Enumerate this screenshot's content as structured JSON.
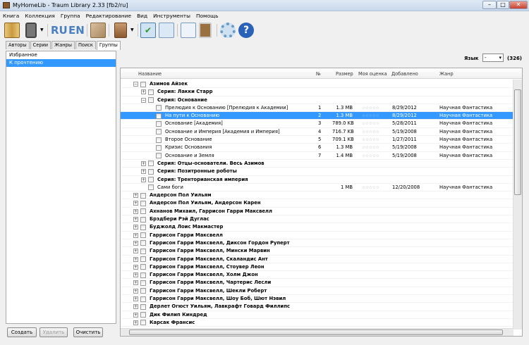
{
  "window": {
    "title": "MyHomeLib - Traum Library 2.33 [fb2/ru]"
  },
  "menu": [
    "Книга",
    "Коллекция",
    "Группа",
    "Редактирование",
    "Вид",
    "Инструменты",
    "Помощь"
  ],
  "toolbar": {
    "ru": "RU",
    "en": "EN"
  },
  "tabs": [
    "Авторы",
    "Серии",
    "Жанры",
    "Поиск",
    "Группы"
  ],
  "groups": [
    "Избранное",
    "К прочтению"
  ],
  "buttons": {
    "create": "Создать",
    "delete": "Удалить",
    "clear": "Очистить"
  },
  "filter": {
    "lang_label": "Язык",
    "lang_value": "-",
    "count": "(326)"
  },
  "columns": {
    "name": "Название",
    "num": "№",
    "size": "Размер",
    "rating": "Моя оценка",
    "added": "Добавлено",
    "genre": "Жанр"
  },
  "rows": [
    {
      "level": 0,
      "exp": "-",
      "bold": true,
      "name": "Азимов Айзек"
    },
    {
      "level": 1,
      "exp": "+",
      "bold": true,
      "name": "Серия: Лакки Старр"
    },
    {
      "level": 1,
      "exp": "-",
      "bold": true,
      "name": "Серия: Основание"
    },
    {
      "level": 2,
      "name": "Прелюдия к Основанию [Прелюдия к Академии]",
      "num": "1",
      "size": "1.3 MB",
      "rating": "☆☆☆☆☆",
      "added": "8/29/2012",
      "genre": "Научная Фантастика"
    },
    {
      "level": 2,
      "sel": true,
      "name": "На пути к Основанию",
      "num": "2",
      "size": "1.3 MB",
      "rating": "☆☆☆☆☆",
      "added": "8/29/2012",
      "genre": "Научная Фантастика"
    },
    {
      "level": 2,
      "name": "Основание [Академия]",
      "num": "3",
      "size": "789.0 KB",
      "rating": "☆☆☆☆☆",
      "added": "5/28/2011",
      "genre": "Научная Фантастика"
    },
    {
      "level": 2,
      "name": "Основание и Империя [Академия и Империя]",
      "num": "4",
      "size": "716.7 KB",
      "rating": "☆☆☆☆☆",
      "added": "5/19/2008",
      "genre": "Научная Фантастика"
    },
    {
      "level": 2,
      "name": "Второе Основание",
      "num": "5",
      "size": "709.1 KB",
      "rating": "☆☆☆☆☆",
      "added": "1/27/2011",
      "genre": "Научная Фантастика"
    },
    {
      "level": 2,
      "name": "Кризис Основания",
      "num": "6",
      "size": "1.3 MB",
      "rating": "☆☆☆☆☆",
      "added": "5/19/2008",
      "genre": "Научная Фантастика"
    },
    {
      "level": 2,
      "name": "Основание и Земля",
      "num": "7",
      "size": "1.4 MB",
      "rating": "☆☆☆☆☆",
      "added": "5/19/2008",
      "genre": "Научная Фантастика"
    },
    {
      "level": 1,
      "exp": "+",
      "bold": true,
      "name": "Серия: Отцы-основатели. Весь Азимов"
    },
    {
      "level": 1,
      "exp": "+",
      "bold": true,
      "name": "Серия: Позитронные роботы"
    },
    {
      "level": 1,
      "exp": "+",
      "bold": true,
      "name": "Серия: Тренторианская империя"
    },
    {
      "level": 1,
      "name": "Сами боги",
      "num": "",
      "size": "1 MB",
      "rating": "☆☆☆☆☆",
      "added": "12/20/2008",
      "genre": "Научная Фантастика"
    },
    {
      "level": 0,
      "exp": "+",
      "bold": true,
      "name": "Андерсон Пол Уильям"
    },
    {
      "level": 0,
      "exp": "+",
      "bold": true,
      "name": "Андерсон Пол Уильям, Андерсон Карен"
    },
    {
      "level": 0,
      "exp": "+",
      "bold": true,
      "name": "Ахнанов Михаил, Гаррисон Гарри Максвелл"
    },
    {
      "level": 0,
      "exp": "+",
      "bold": true,
      "name": "Брэдбери Рэй Дуглас"
    },
    {
      "level": 0,
      "exp": "+",
      "bold": true,
      "name": "Буджолд Лоис Макмастер"
    },
    {
      "level": 0,
      "exp": "+",
      "bold": true,
      "name": "Гаррисон Гарри Максвелл"
    },
    {
      "level": 0,
      "exp": "+",
      "bold": true,
      "name": "Гаррисон Гарри Максвелл, Диксон Гордон Руперт"
    },
    {
      "level": 0,
      "exp": "+",
      "bold": true,
      "name": "Гаррисон Гарри Максвелл, Мински Марвин"
    },
    {
      "level": 0,
      "exp": "+",
      "bold": true,
      "name": "Гаррисон Гарри Максвелл, Скаландис Ант"
    },
    {
      "level": 0,
      "exp": "+",
      "bold": true,
      "name": "Гаррисон Гарри Максвелл, Стоувер Леон"
    },
    {
      "level": 0,
      "exp": "+",
      "bold": true,
      "name": "Гаррисон Гарри Максвелл, Холм Джон"
    },
    {
      "level": 0,
      "exp": "+",
      "bold": true,
      "name": "Гаррисон Гарри Максвелл, Чартерис Лесли"
    },
    {
      "level": 0,
      "exp": "+",
      "bold": true,
      "name": "Гаррисон Гарри Максвелл, Шекли Роберт"
    },
    {
      "level": 0,
      "exp": "+",
      "bold": true,
      "name": "Гаррисон Гарри Максвелл, Шоу Боб, Шют Нэвил"
    },
    {
      "level": 0,
      "exp": "+",
      "bold": true,
      "name": "Дерлет Огюст Уильям, Лавкрафт Говард Филлипс"
    },
    {
      "level": 0,
      "exp": "+",
      "bold": true,
      "name": "Дик Филип Киндред"
    },
    {
      "level": 0,
      "exp": "+",
      "bold": true,
      "name": "Карсак Франсис"
    }
  ]
}
